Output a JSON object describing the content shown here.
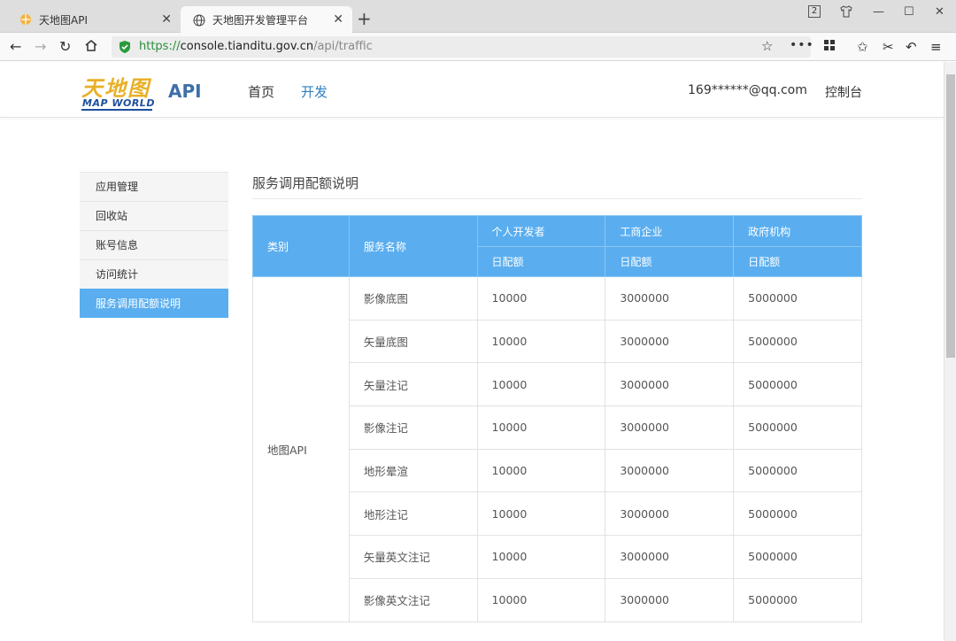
{
  "browser": {
    "tabs": [
      {
        "title": "天地图API",
        "icon": "tianditu-favicon",
        "active": false
      },
      {
        "title": "天地图开发管理平台",
        "icon": "globe-icon",
        "active": true
      }
    ],
    "new_tab_symbol": "+",
    "window_badge": "2",
    "url": {
      "scheme": "https://",
      "host": "console.tianditu.gov.cn",
      "path": "/api/traffic"
    }
  },
  "header": {
    "logo_cn": "天地图",
    "logo_en": "MAP WORLD",
    "api_label": "API",
    "nav": [
      {
        "label": "首页",
        "active": false
      },
      {
        "label": "开发",
        "active": true
      }
    ],
    "user_email": "169******@qq.com",
    "console_link": "控制台"
  },
  "sidebar": {
    "items": [
      {
        "label": "应用管理",
        "active": false
      },
      {
        "label": "回收站",
        "active": false
      },
      {
        "label": "账号信息",
        "active": false
      },
      {
        "label": "访问统计",
        "active": false
      },
      {
        "label": "服务调用配额说明",
        "active": true
      }
    ]
  },
  "content": {
    "title": "服务调用配额说明",
    "table": {
      "headers": {
        "category": "类别",
        "service": "服务名称",
        "groups": [
          "个人开发者",
          "工商企业",
          "政府机构"
        ],
        "sub": [
          "日配额",
          "日配额",
          "日配额"
        ]
      },
      "category": "地图API",
      "rows": [
        {
          "service": "影像底图",
          "personal": "10000",
          "business": "3000000",
          "government": "5000000"
        },
        {
          "service": "矢量底图",
          "personal": "10000",
          "business": "3000000",
          "government": "5000000"
        },
        {
          "service": "矢量注记",
          "personal": "10000",
          "business": "3000000",
          "government": "5000000"
        },
        {
          "service": "影像注记",
          "personal": "10000",
          "business": "3000000",
          "government": "5000000"
        },
        {
          "service": "地形晕渲",
          "personal": "10000",
          "business": "3000000",
          "government": "5000000"
        },
        {
          "service": "地形注记",
          "personal": "10000",
          "business": "3000000",
          "government": "5000000"
        },
        {
          "service": "矢量英文注记",
          "personal": "10000",
          "business": "3000000",
          "government": "5000000"
        },
        {
          "service": "影像英文注记",
          "personal": "10000",
          "business": "3000000",
          "government": "5000000"
        }
      ]
    }
  },
  "colors": {
    "accent": "#5aaeef",
    "nav_active": "#2f7fc0",
    "url_secure": "#2a8f3c",
    "logo_gold": "#e8b028",
    "logo_blue": "#1d4f9c"
  }
}
